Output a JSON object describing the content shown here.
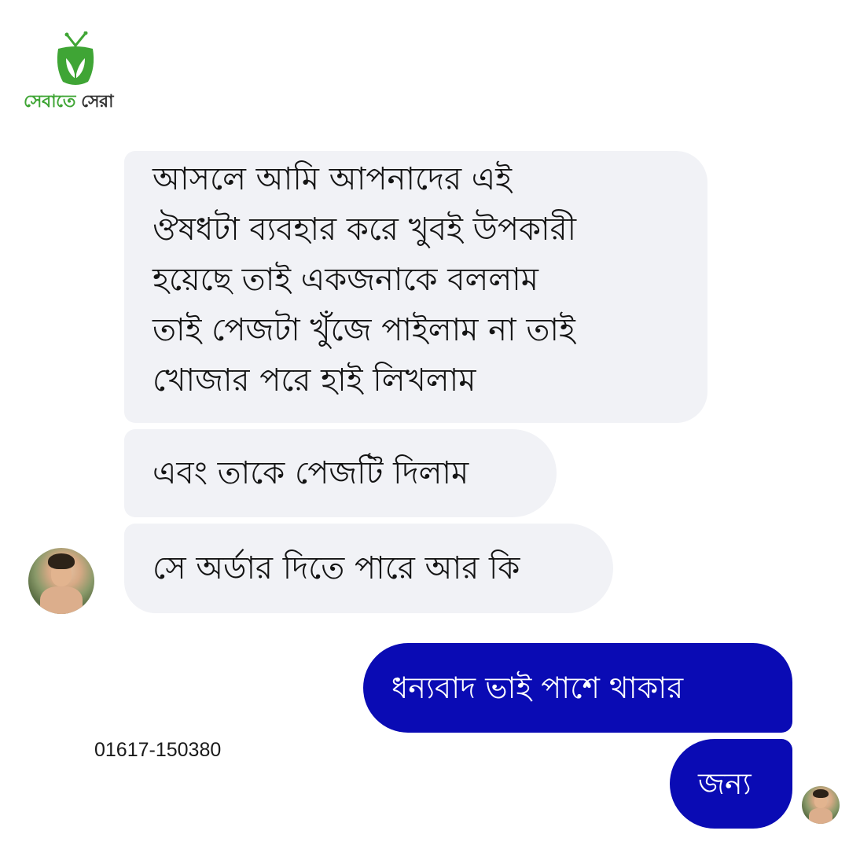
{
  "brand": {
    "logo_text_green": "সেবাতে",
    "logo_text_dark": " সেরা",
    "green_color": "#3fa535",
    "icon": "tv-leaf-logo-icon"
  },
  "chat": {
    "received_bubble_color": "#f1f2f6",
    "sent_bubble_color": "#0a0bb4",
    "received": {
      "message1_lines": [
        "আসলে আমি আপনাদের এই",
        "ঔষধটা ব্যবহার করে খুবই উপকারী",
        "হয়েছে তাই একজনাকে বললাম",
        "তাই পেজটা খুঁজে পাইলাম না তাই",
        "খোজার পরে হাই লিখলাম"
      ],
      "message2": "এবং তাকে পেজটি দিলাম",
      "message3": "সে অর্ডার দিতে পারে আর কি"
    },
    "sent": {
      "message1": "ধন্যবাদ ভাই পাশে থাকার",
      "message2": "জন্য"
    }
  },
  "contact": {
    "phone": "01617-150380"
  }
}
